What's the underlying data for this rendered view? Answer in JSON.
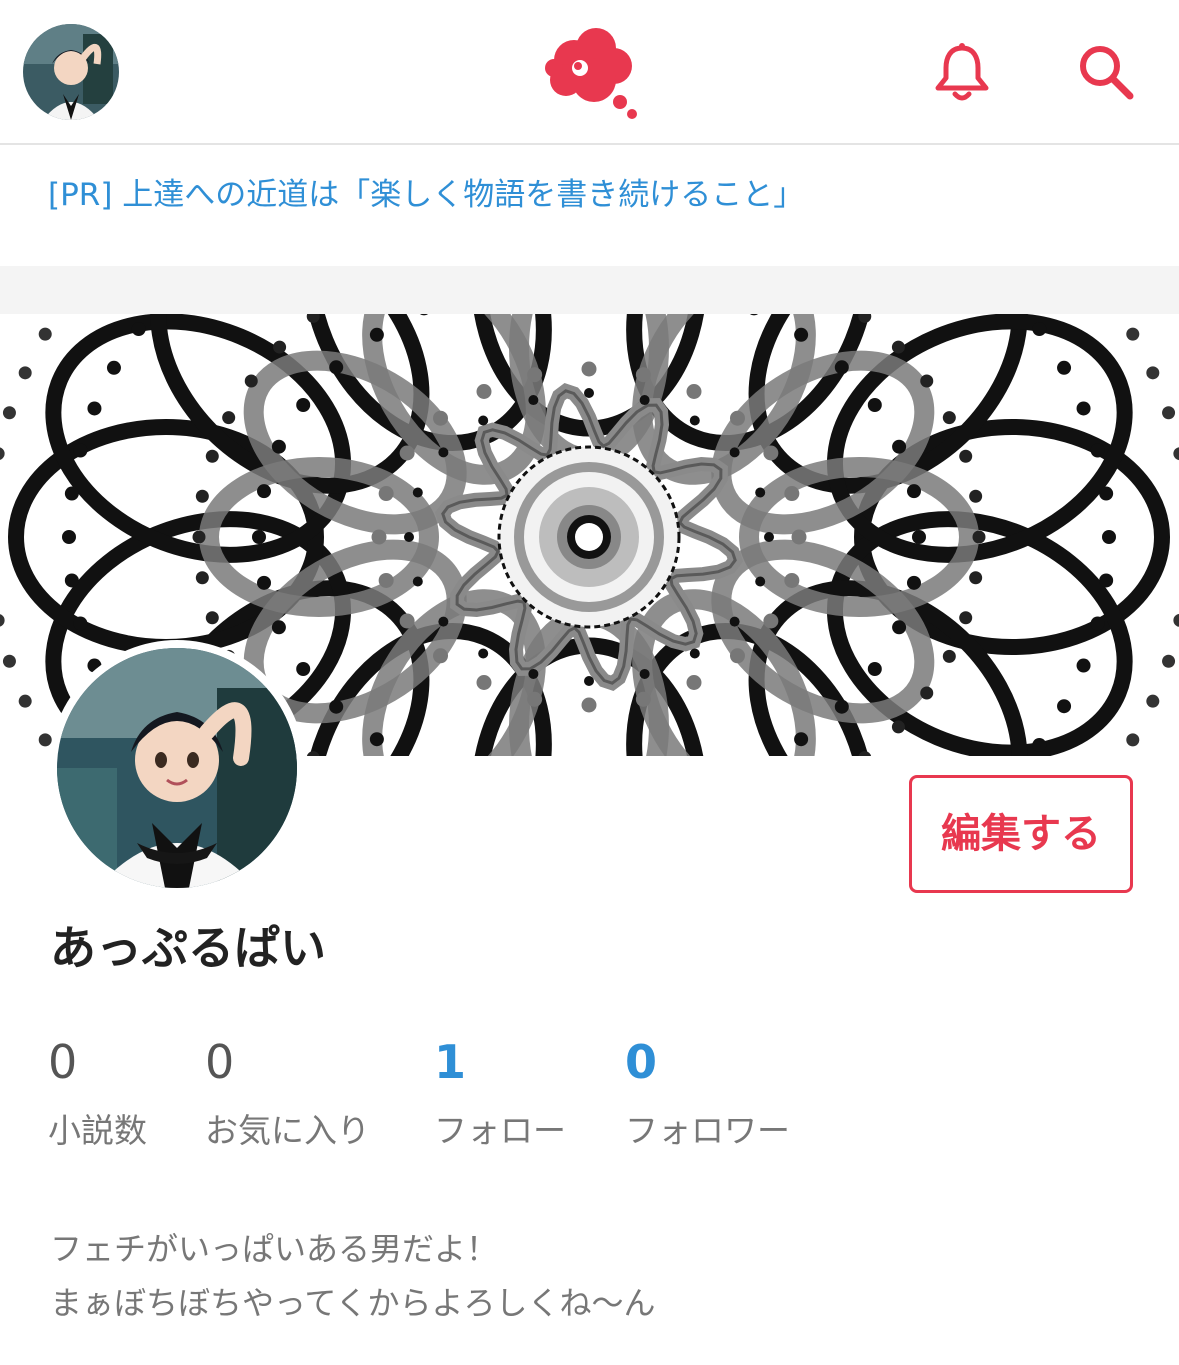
{
  "header": {
    "avatar_icon": "user-avatar",
    "logo_icon": "speech-bubble-logo",
    "bell_icon": "bell-icon",
    "search_icon": "search-icon",
    "accent_color": "#e8384f"
  },
  "pr_banner": {
    "text": "[PR] 上達への近道は「楽しく物語を書き続けること」",
    "color": "#2f8fd6"
  },
  "profile": {
    "name": "あっぷるぱい",
    "edit_label": "編集する",
    "stats": [
      {
        "value": "0",
        "label": "小説数"
      },
      {
        "value": "0",
        "label": "お気に入り"
      },
      {
        "value": "1",
        "label": "フォロー"
      },
      {
        "value": "0",
        "label": "フォロワー"
      }
    ],
    "bio_lines": [
      "フェチがいっぱいある男だよ！",
      "まぁぼちぼちやってくからよろしくね〜ん"
    ]
  }
}
